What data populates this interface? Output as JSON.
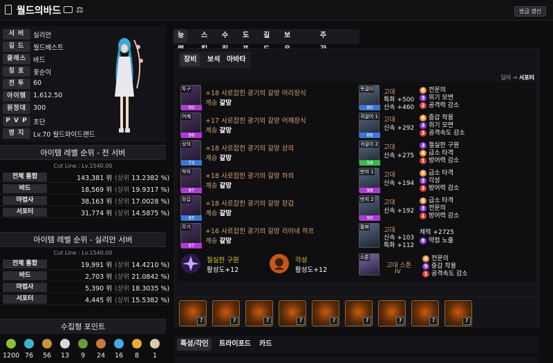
{
  "header": {
    "title": "월드의바드",
    "refresh_label": "방금 갱신"
  },
  "profile": {
    "rows": [
      {
        "label": "서 버",
        "value": "실리안"
      },
      {
        "label": "길 드",
        "value": "월드베스트"
      },
      {
        "label": "클래스",
        "value": "바드"
      },
      {
        "label": "칭 호",
        "value": "꽃순이"
      },
      {
        "label": "전 투",
        "value": "60"
      },
      {
        "label": "아이템",
        "value": "1,612.50"
      },
      {
        "label": "원정대",
        "value": "300"
      },
      {
        "label": "P V P",
        "value": "초단"
      },
      {
        "label": "영 지",
        "value": "Lv.70 월드와이드랜드"
      }
    ]
  },
  "rank_all": {
    "title": "아이템 레벨 순위 - 전 서버",
    "cutline": "Cut Line : Lv.1540.00",
    "rows": [
      {
        "name": "전체 통합",
        "value": "143,381 위",
        "upper": "(상위",
        "pct": "13.2382 %)"
      },
      {
        "name": "바드",
        "value": "18,569 위",
        "upper": "(상위",
        "pct": "19.9317 %)"
      },
      {
        "name": "마법사",
        "value": "38,163 위",
        "upper": "(상위",
        "pct": "17.0028 %)"
      },
      {
        "name": "서포터",
        "value": "31,774 위",
        "upper": "(상위",
        "pct": "14.5875 %)"
      }
    ]
  },
  "rank_server": {
    "title": "아이템 레벨 순위 - 실리안 서버",
    "cutline": "Cut Line : Lv.1540.00",
    "rows": [
      {
        "name": "전체 통합",
        "value": "19,991 위",
        "upper": "(상위",
        "pct": "14.4210 %)"
      },
      {
        "name": "바드",
        "value": "2,703 위",
        "upper": "(상위",
        "pct": "21.0842 %)"
      },
      {
        "name": "마법사",
        "value": "5,390 위",
        "upper": "(상위",
        "pct": "18.3035 %)"
      },
      {
        "name": "서포터",
        "value": "4,445 위",
        "upper": "(상위",
        "pct": "15.5382 %)"
      }
    ]
  },
  "collect": {
    "title": "수집형 포인트",
    "items": [
      {
        "icon": "island-heart-icon",
        "color": "#8fbf3a",
        "count": "1200"
      },
      {
        "icon": "island-icon",
        "color": "#3ab8c8",
        "count": "76"
      },
      {
        "icon": "art-icon",
        "color": "#c8963a",
        "count": "56"
      },
      {
        "icon": "mococo-icon",
        "color": "#d8d8d8",
        "count": "13"
      },
      {
        "icon": "world-tree-icon",
        "color": "#6a9a3a",
        "count": "9"
      },
      {
        "icon": "ignea-icon",
        "color": "#c87a3a",
        "count": "24"
      },
      {
        "icon": "star-icon",
        "color": "#4aa8e8",
        "count": "16"
      },
      {
        "icon": "heart-icon",
        "color": "#e8a83a",
        "count": "8"
      },
      {
        "icon": "orpheus-icon",
        "color": "#d8c8a8",
        "count": "1"
      }
    ]
  },
  "main_tabs": [
    "능력치",
    "스킬",
    "수집",
    "도표",
    "길드",
    "보유 캐릭터",
    "주간골드획득"
  ],
  "sub_tabs": [
    "장비",
    "보석",
    "아바타"
  ],
  "dealer_sup": {
    "dealer": "딜러",
    "arrow": "→",
    "support": "서포터"
  },
  "gear": [
    {
      "tag": "투구",
      "quality": "90",
      "quality_color": "#b03ad8",
      "name": "+18 사로잡힌 광기의 갈망 머리장식",
      "sub_label": "계승",
      "sub_value": "갈망"
    },
    {
      "tag": "어깨",
      "quality": "98",
      "quality_color": "#b03ad8",
      "name": "+17 사로잡힌 광기의 갈망 어깨장식",
      "sub_label": "계승",
      "sub_value": "갈망"
    },
    {
      "tag": "상의",
      "quality": "73",
      "quality_color": "#3a78d8",
      "name": "+18 사로잡힌 광기의 갈망 상의",
      "sub_label": "계승",
      "sub_value": "갈망"
    },
    {
      "tag": "하의",
      "quality": "97",
      "quality_color": "#b03ad8",
      "name": "+18 사로잡힌 광기의 갈망 하의",
      "sub_label": "계승",
      "sub_value": "갈망"
    },
    {
      "tag": "장갑",
      "quality": "85",
      "quality_color": "#3a78d8",
      "name": "+18 사로잡힌 광기의 갈망 장갑",
      "sub_label": "계승",
      "sub_value": "갈망"
    },
    {
      "tag": "무기",
      "quality": "97",
      "quality_color": "#b03ad8",
      "name": "+16 사로잡힌 광기의 갈망 리아네 하프",
      "sub_label": "계승",
      "sub_value": "갈망"
    }
  ],
  "accessories": [
    {
      "tag": "목걸이",
      "quality": "80",
      "quality_color": "#3a78d8",
      "grade": "고대",
      "stats": [
        "특화 +500",
        "신속 +460"
      ],
      "engravings": [
        {
          "n": "6",
          "c": "#e8943a",
          "t": "전문의"
        },
        {
          "n": "3",
          "c": "#8a3ad8",
          "t": "위기 모면"
        },
        {
          "n": "2",
          "c": "#d83a3a",
          "t": "공격력 감소"
        }
      ]
    },
    {
      "tag": "귀걸이 1",
      "quality": "86",
      "quality_color": "#3a78d8",
      "grade": "고대",
      "stats": [
        "신속 +292"
      ],
      "engravings": [
        {
          "n": "6",
          "c": "#e8943a",
          "t": "중갑 착용"
        },
        {
          "n": "3",
          "c": "#8a3ad8",
          "t": "위기 모면"
        },
        {
          "n": "3",
          "c": "#d83a3a",
          "t": "공격속도 감소"
        }
      ]
    },
    {
      "tag": "귀걸이 2",
      "quality": "58",
      "quality_color": "#3ab84a",
      "grade": "고대",
      "stats": [
        "신속 +275"
      ],
      "engravings": [
        {
          "n": "3",
          "c": "#8a3ad8",
          "t": "절실한 구원"
        },
        {
          "n": "4",
          "c": "#e8943a",
          "t": "급소 타격"
        },
        {
          "n": "1",
          "c": "#d83a3a",
          "t": "방어력 감소"
        }
      ]
    },
    {
      "tag": "반지 1",
      "quality": "98",
      "quality_color": "#b03ad8",
      "grade": "고대",
      "stats": [
        "신속 +194"
      ],
      "engravings": [
        {
          "n": "6",
          "c": "#e8943a",
          "t": "급소 타격"
        },
        {
          "n": "3",
          "c": "#8a3ad8",
          "t": "각성"
        },
        {
          "n": "3",
          "c": "#d83a3a",
          "t": "방어력 감소"
        }
      ]
    },
    {
      "tag": "반지 2",
      "quality": "90",
      "quality_color": "#b03ad8",
      "grade": "고대",
      "stats": [
        "신속 +192"
      ],
      "engravings": [
        {
          "n": "6",
          "c": "#e8943a",
          "t": "급소 타격"
        },
        {
          "n": "3",
          "c": "#8a3ad8",
          "t": "전문의"
        },
        {
          "n": "1",
          "c": "#d83a3a",
          "t": "방어력 감소"
        }
      ]
    },
    {
      "tag": "팔찌",
      "quality": "",
      "quality_color": "#000000",
      "grade": "고대",
      "stats": [
        "신속 +103",
        "특화 +112"
      ],
      "engravings": [
        {
          "n": "",
          "c": "#000000",
          "t": "체력 +2725"
        },
        {
          "n": "8",
          "c": "#8a3ad8",
          "t": "약점 노출"
        }
      ]
    }
  ],
  "bracelet_row": {
    "engrave1": {
      "name": "절실한 구원",
      "level": "활성도+12"
    },
    "engrave2": {
      "name": "각성",
      "level": "활성도+12"
    },
    "stone": {
      "tag": "스톤",
      "name": "고대 스톤",
      "tier": "IV",
      "engravings": [
        {
          "n": "6",
          "c": "#e8943a",
          "t": "전문의"
        },
        {
          "n": "9",
          "c": "#8a3ad8",
          "t": "중갑 착용"
        },
        {
          "n": "1",
          "c": "#d83a3a",
          "t": "공격속도 감소"
        }
      ]
    }
  },
  "gems": [
    "7",
    "7",
    "7",
    "7",
    "7",
    "7",
    "7",
    "7",
    "7"
  ],
  "bottom_tabs": [
    "특성/각인",
    "트라이포드",
    "카드"
  ]
}
